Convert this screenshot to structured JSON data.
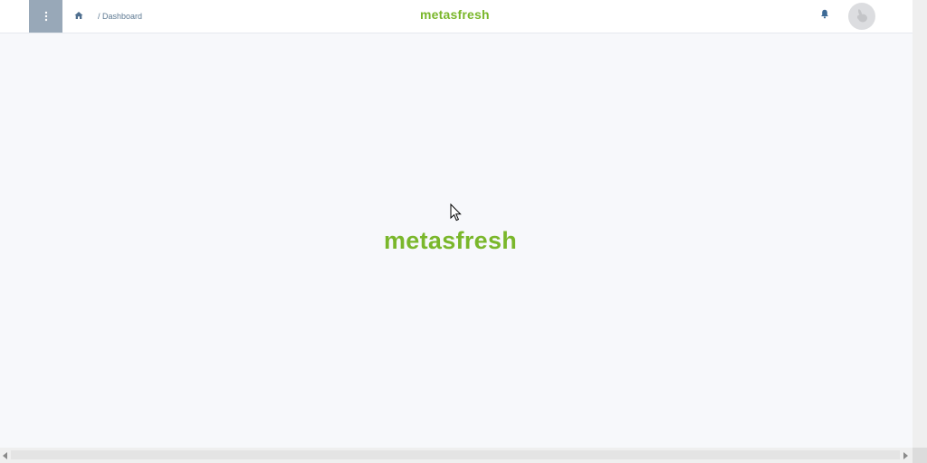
{
  "header": {
    "menu_icon": "vertical-dots-icon",
    "home_icon": "home-icon",
    "breadcrumb": "/ Dashboard",
    "logo": "metasfresh",
    "bell_icon": "bell-icon",
    "avatar_icon": "user-avatar-icon"
  },
  "main": {
    "logo": "metasfresh"
  },
  "colors": {
    "brand_green": "#7ab72b",
    "menu_bg": "#98a8b8",
    "breadcrumb_text": "#5e7a93",
    "page_bg": "#f7f8fb"
  }
}
